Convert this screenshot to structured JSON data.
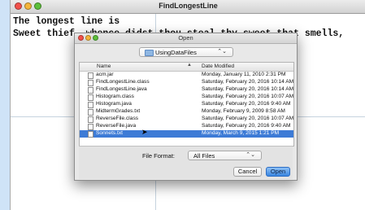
{
  "app": {
    "title": "FindLongestLine",
    "console": [
      "The longest line is",
      "Sweet thief, whence didst thou steal thy sweet that smells,"
    ]
  },
  "dialog": {
    "title": "Open",
    "folder": "UsingDataFiles",
    "columns": {
      "name": "Name",
      "date": "Date Modified"
    },
    "files": [
      {
        "name": "acm.jar",
        "date": "Monday, January 11, 2010 2:31 PM"
      },
      {
        "name": "FindLongestLine.class",
        "date": "Saturday, February 20, 2016 10:14 AM"
      },
      {
        "name": "FindLongestLine.java",
        "date": "Saturday, February 20, 2016 10:14 AM"
      },
      {
        "name": "Histogram.class",
        "date": "Saturday, February 20, 2016 10:07 AM"
      },
      {
        "name": "Histogram.java",
        "date": "Saturday, February 20, 2016 9:40 AM"
      },
      {
        "name": "MidtermGrades.txt",
        "date": "Monday, February 9, 2009 8:58 AM"
      },
      {
        "name": "ReverseFile.class",
        "date": "Saturday, February 20, 2016 10:07 AM"
      },
      {
        "name": "ReverseFile.java",
        "date": "Saturday, February 20, 2016 9:40 AM"
      },
      {
        "name": "Sonnets.txt",
        "date": "Monday, March 9, 2015 1:21 PM"
      }
    ],
    "selected_file": "Sonnets.txt",
    "file_format_label": "File Format:",
    "file_format_value": "All Files",
    "cancel_label": "Cancel",
    "open_label": "Open"
  },
  "colors": {
    "desktop": "#cfe3f7",
    "selection": "#3d7bd6",
    "default_button": "#3a86e0"
  }
}
